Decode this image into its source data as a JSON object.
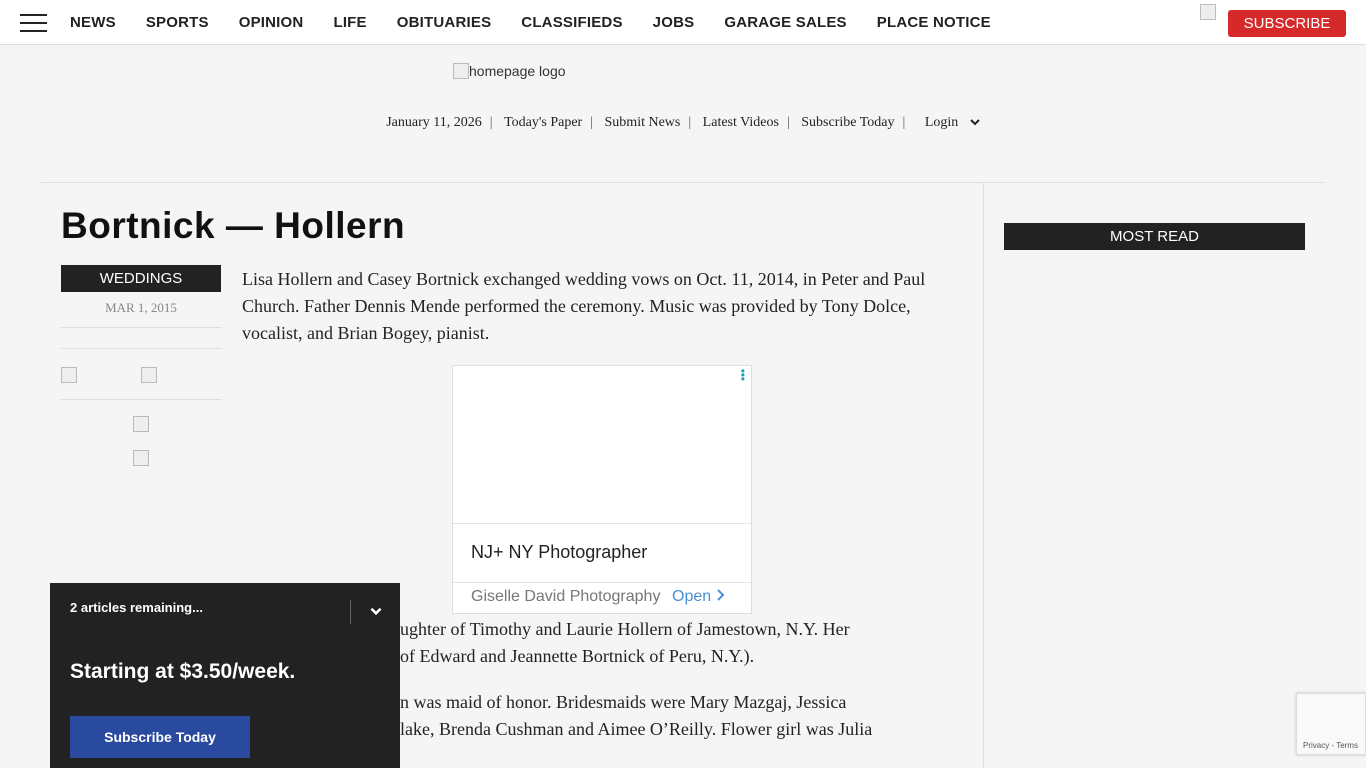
{
  "nav": {
    "items": [
      "NEWS",
      "SPORTS",
      "OPINION",
      "LIFE",
      "OBITUARIES",
      "CLASSIFIEDS",
      "JOBS",
      "GARAGE SALES",
      "PLACE NOTICE"
    ],
    "subscribe": "SUBSCRIBE"
  },
  "logo": {
    "alt": "homepage logo"
  },
  "utility": {
    "date": "January 11, 2026",
    "todays_paper": "Today's Paper",
    "submit_news": "Submit News",
    "latest_videos": "Latest Videos",
    "subscribe_today": "Subscribe Today",
    "login": "Login"
  },
  "article": {
    "title": "Bortnick — Hollern",
    "category": "WEDDINGS",
    "date": "MAR 1, 2015",
    "p1": "Lisa Hollern and Casey Bortnick exchanged wedding vows on Oct. 11, 2014, in Peter and Paul Church. Father Dennis Mende performed the ceremony. Music was provided by Tony Dolce, vocalist, and Brian Bogey, pianist.",
    "p2_line1": "ughter of Timothy and Laurie Hollern of Jamestown, N.Y. Her",
    "p2_line2": "of Edward and Jeannette Bortnick of Peru, N.Y.).",
    "p3_line1": "n was maid of honor. Bridesmaids were Mary Mazgaj, Jessica",
    "p3_line2": "lake, Brenda Cushman and Aimee O’Reilly. Flower girl was Julia"
  },
  "ad": {
    "title": "NJ+ NY Photographer",
    "advertiser": "Giselle David Photography",
    "cta": "Open"
  },
  "paywall": {
    "remaining": "2 articles remaining...",
    "price": "Starting at $3.50/week.",
    "button": "Subscribe Today"
  },
  "sidebar": {
    "most_read": "MOST READ"
  },
  "recaptcha": {
    "terms": "Privacy - Terms"
  }
}
